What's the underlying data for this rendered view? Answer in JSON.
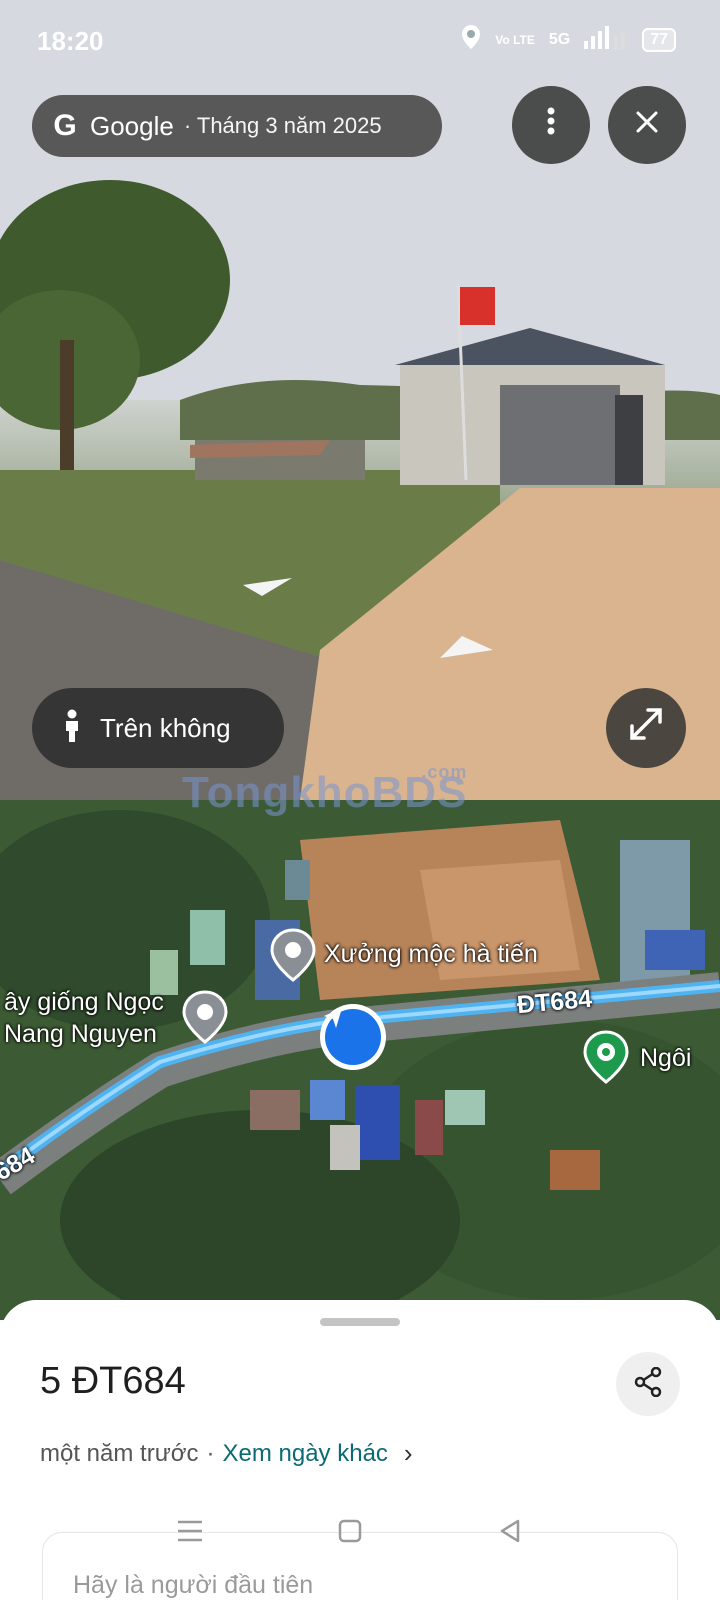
{
  "status_bar": {
    "time": "18:20",
    "volte": "Vo LTE",
    "network": "5G",
    "battery": "77"
  },
  "street_view": {
    "brand": "Google",
    "date": "· Tháng 3 năm 2025",
    "aerial_label": "Trên không"
  },
  "map": {
    "watermark": "TongkhoBDS",
    "watermark_suffix": ".com",
    "road_label_right": "ĐT684",
    "road_label_left": "684",
    "place_1": "Xưởng mộc hà tiến",
    "place_2_line1": "ây giống Ngọc",
    "place_2_line2": "Nang Nguyen",
    "place_3": "Ngôi"
  },
  "sheet": {
    "address": "5 ĐT684",
    "time_ago": "một năm trước",
    "separator": "·",
    "other_dates_link": "Xem ngày khác",
    "review_prompt": "Hãy là người đầu tiên"
  },
  "icons": {
    "menu": "more-vert-icon",
    "close": "close-icon",
    "expand": "expand-icon",
    "person": "person-icon",
    "share": "share-icon",
    "location_arrow": "navigation-arrow-icon"
  },
  "colors": {
    "route": "#4fb3f0",
    "link": "#0b6b74"
  }
}
